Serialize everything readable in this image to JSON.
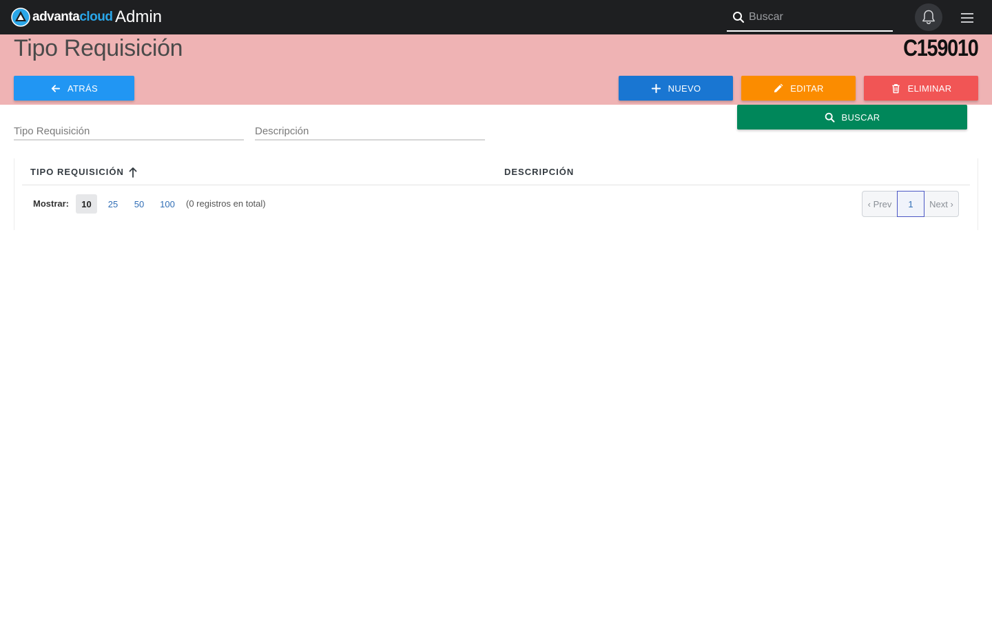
{
  "navbar": {
    "logo": {
      "part1": "advanta",
      "part2": "cloud",
      "icon": "advanta-logo-icon"
    },
    "app_title": "Admin",
    "search": {
      "placeholder": "Buscar",
      "value": ""
    },
    "notification_icon": "bell-icon",
    "menu_icon": "hamburger-menu-icon"
  },
  "header": {
    "title": "Tipo Requisición",
    "record_code": "C159010",
    "background_color": "#efb3b4"
  },
  "actions": {
    "back_label": "ATRÁS",
    "new_label": "NUEVO",
    "edit_label": "EDITAR",
    "delete_label": "ELIMINAR",
    "search_label": "BUSCAR"
  },
  "filters": {
    "tipo": {
      "placeholder": "Tipo Requisición",
      "value": ""
    },
    "descripcion": {
      "placeholder": "Descripción",
      "value": ""
    }
  },
  "table": {
    "columns": [
      {
        "label": "TIPO REQUISICIÓN",
        "sort": "ascending"
      },
      {
        "label": "DESCRIPCIÓN"
      }
    ],
    "rows": []
  },
  "pagination": {
    "show_label": "Mostrar:",
    "page_sizes": [
      "10",
      "25",
      "50",
      "100"
    ],
    "selected_size": "10",
    "total_text": "(0 registros en total)",
    "prev_label": "‹ Prev",
    "current_page": "1",
    "next_label": "Next ›"
  },
  "colors": {
    "navbar": "#1e1f21",
    "back": "#2196f3",
    "new": "#1976d2",
    "edit": "#fb8c00",
    "delete": "#f15555",
    "search": "#00875a"
  }
}
